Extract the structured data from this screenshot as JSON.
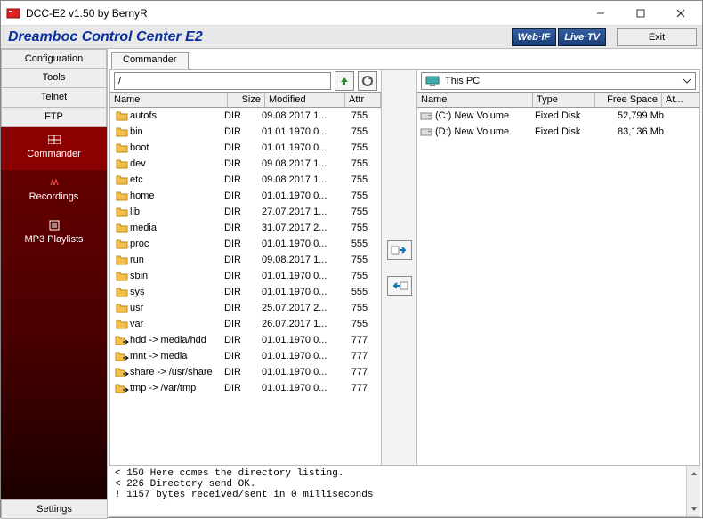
{
  "titlebar": {
    "text": "DCC-E2 v1.50 by BernyR"
  },
  "header": {
    "apptitle": "Dreamboc Control Center E2",
    "webif": "Web·IF",
    "livetv": "Live·TV",
    "exit": "Exit"
  },
  "sidebar": {
    "top": [
      "Configuration",
      "Tools",
      "Telnet",
      "FTP"
    ],
    "dark": [
      {
        "label": "Commander",
        "active": true
      },
      {
        "label": "Recordings"
      },
      {
        "label": "MP3 Playlists"
      }
    ],
    "settings": "Settings"
  },
  "tab": {
    "label": "Commander"
  },
  "left": {
    "path": "/",
    "cols": {
      "name": "Name",
      "size": "Size",
      "mod": "Modified",
      "attr": "Attr"
    },
    "rows": [
      {
        "icon": "folder",
        "name": "autofs",
        "size": "DIR",
        "mod": "09.08.2017 1...",
        "attr": "755"
      },
      {
        "icon": "folder",
        "name": "bin",
        "size": "DIR",
        "mod": "01.01.1970 0...",
        "attr": "755"
      },
      {
        "icon": "folder",
        "name": "boot",
        "size": "DIR",
        "mod": "01.01.1970 0...",
        "attr": "755"
      },
      {
        "icon": "folder",
        "name": "dev",
        "size": "DIR",
        "mod": "09.08.2017 1...",
        "attr": "755"
      },
      {
        "icon": "folder",
        "name": "etc",
        "size": "DIR",
        "mod": "09.08.2017 1...",
        "attr": "755"
      },
      {
        "icon": "folder",
        "name": "home",
        "size": "DIR",
        "mod": "01.01.1970 0...",
        "attr": "755"
      },
      {
        "icon": "folder",
        "name": "lib",
        "size": "DIR",
        "mod": "27.07.2017 1...",
        "attr": "755"
      },
      {
        "icon": "folder",
        "name": "media",
        "size": "DIR",
        "mod": "31.07.2017 2...",
        "attr": "755"
      },
      {
        "icon": "folder",
        "name": "proc",
        "size": "DIR",
        "mod": "01.01.1970 0...",
        "attr": "555"
      },
      {
        "icon": "folder",
        "name": "run",
        "size": "DIR",
        "mod": "09.08.2017 1...",
        "attr": "755"
      },
      {
        "icon": "folder",
        "name": "sbin",
        "size": "DIR",
        "mod": "01.01.1970 0...",
        "attr": "755"
      },
      {
        "icon": "folder",
        "name": "sys",
        "size": "DIR",
        "mod": "01.01.1970 0...",
        "attr": "555"
      },
      {
        "icon": "folder",
        "name": "usr",
        "size": "DIR",
        "mod": "25.07.2017 2...",
        "attr": "755"
      },
      {
        "icon": "folder",
        "name": "var",
        "size": "DIR",
        "mod": "26.07.2017 1...",
        "attr": "755"
      },
      {
        "icon": "link",
        "name": "hdd -> media/hdd",
        "size": "DIR",
        "mod": "01.01.1970 0...",
        "attr": "777"
      },
      {
        "icon": "link",
        "name": "mnt -> media",
        "size": "DIR",
        "mod": "01.01.1970 0...",
        "attr": "777"
      },
      {
        "icon": "link",
        "name": "share -> /usr/share",
        "size": "DIR",
        "mod": "01.01.1970 0...",
        "attr": "777"
      },
      {
        "icon": "link",
        "name": "tmp -> /var/tmp",
        "size": "DIR",
        "mod": "01.01.1970 0...",
        "attr": "777"
      }
    ]
  },
  "right": {
    "drive": "This PC",
    "cols": {
      "name": "Name",
      "type": "Type",
      "free": "Free Space",
      "at": "At..."
    },
    "rows": [
      {
        "name": "(C:)  New Volume",
        "type": "Fixed Disk",
        "free": "52,799 Mb"
      },
      {
        "name": "(D:)  New Volume",
        "type": "Fixed Disk",
        "free": "83,136 Mb"
      }
    ]
  },
  "log": {
    "l1": "< 150 Here comes the directory listing.",
    "l2": "< 226 Directory send OK.",
    "l3": "! 1157 bytes received/sent in 0 milliseconds"
  }
}
